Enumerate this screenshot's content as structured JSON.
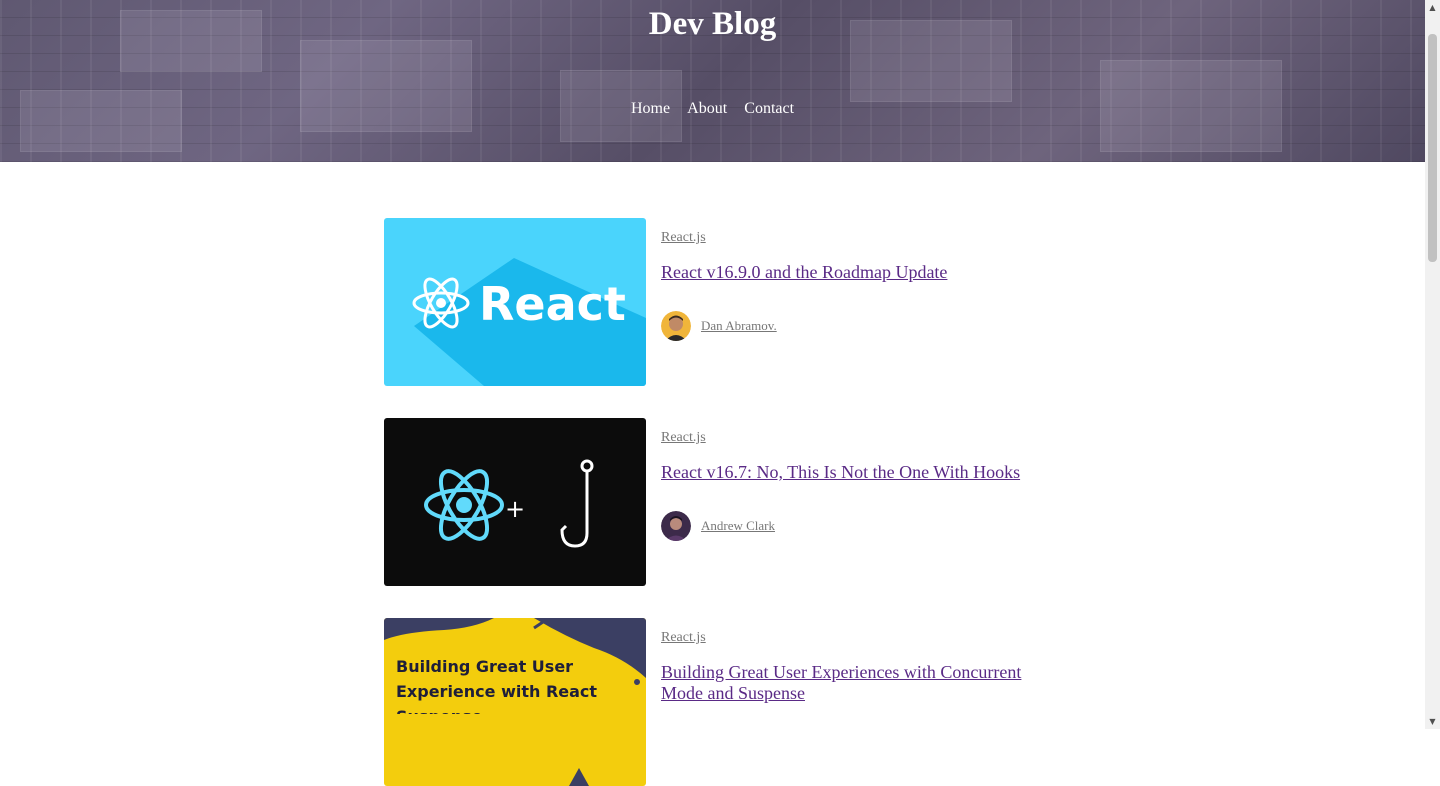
{
  "header": {
    "title": "Dev Blog",
    "nav": [
      "Home",
      "About",
      "Contact"
    ]
  },
  "posts": [
    {
      "category": "React.js",
      "title": "React v16.9.0 and the Roadmap Update",
      "author": "Dan Abramov.",
      "image_text": "React",
      "image_bg": "#4ad4fc"
    },
    {
      "category": "React.js",
      "title": "React v16.7: No, This Is Not the One With Hooks",
      "author": "Andrew Clark",
      "image_text": "+",
      "image_bg": "#0c0c0c"
    },
    {
      "category": "React.js",
      "title": "Building Great User Experiences with Concurrent Mode and Suspense",
      "author": "",
      "image_text": "Building Great User Experience with React Suspense",
      "image_bg": "#f3cd0d"
    }
  ],
  "colors": {
    "link_visited": "#5a2a86",
    "meta_gray": "#777777",
    "react_cyan": "#61dafb"
  }
}
